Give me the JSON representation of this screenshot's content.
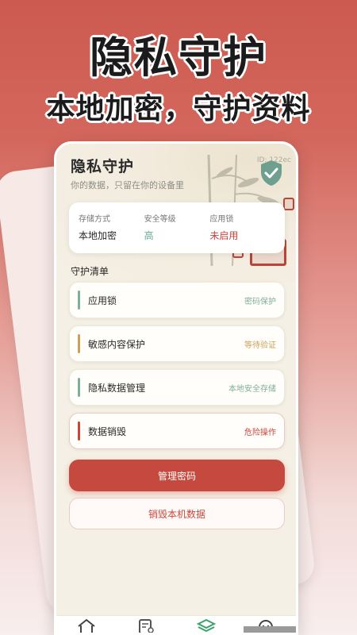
{
  "promo": {
    "headline": "隐私守护",
    "subline": "本地加密，守护资料"
  },
  "screen": {
    "title": "隐私守护",
    "subtitle": "你的数据，只留在你的设备里",
    "id_label": "ID: 122ec",
    "info": [
      {
        "label": "存储方式",
        "value": "本地加密",
        "tone": "default"
      },
      {
        "label": "安全等级",
        "value": "高",
        "tone": "green"
      },
      {
        "label": "应用锁",
        "value": "未启用",
        "tone": "red"
      }
    ],
    "section_title": "守护清单",
    "items": [
      {
        "label": "应用锁",
        "status": "密码保护",
        "bar_color": "#7fae9d",
        "status_color": "#7fae9d"
      },
      {
        "label": "敏感内容保护",
        "status": "等待验证",
        "bar_color": "#c9a15a",
        "status_color": "#c9a15a"
      },
      {
        "label": "隐私数据管理",
        "status": "本地安全存储",
        "bar_color": "#7fae9d",
        "status_color": "#7fae9d"
      },
      {
        "label": "数据销毁",
        "status": "危险操作",
        "bar_color": "#c5473c",
        "status_color": "#c5473c"
      }
    ],
    "primary_button": "管理密码",
    "secondary_button": "销毁本机数据",
    "tabs": [
      "home-icon",
      "notes-icon",
      "layers-icon",
      "face-icon"
    ],
    "colors": {
      "accent": "#c5493e",
      "green": "#6aa88f",
      "gold": "#c9a15a"
    }
  }
}
